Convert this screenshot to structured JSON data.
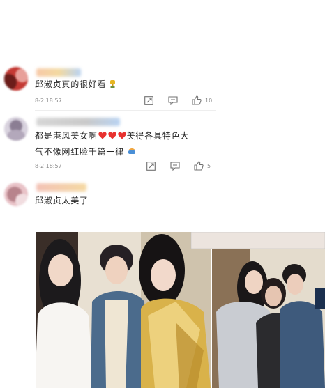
{
  "comments": [
    {
      "text": "邱淑贞真的很好看",
      "emoji": "trophy-emoji",
      "time": "8-2 18:57",
      "like_count": "10"
    },
    {
      "text_line1": "都是港风美女啊",
      "hearts": [
        "heart-emoji",
        "heart-emoji",
        "heart-emoji"
      ],
      "text_line1_after": "美得各具特色大",
      "text_line2": "气不像网红脸千篇一律",
      "emoji": "flower-emoji",
      "time": "8-2 18:57",
      "like_count": "5"
    },
    {
      "text": "邱淑贞太美了"
    }
  ],
  "icons": {
    "share": "share-icon",
    "reply": "comment-icon",
    "like": "thumbs-up-icon"
  },
  "colors": {
    "time_text": "#8a8a8a",
    "heart": "#e8322f"
  }
}
